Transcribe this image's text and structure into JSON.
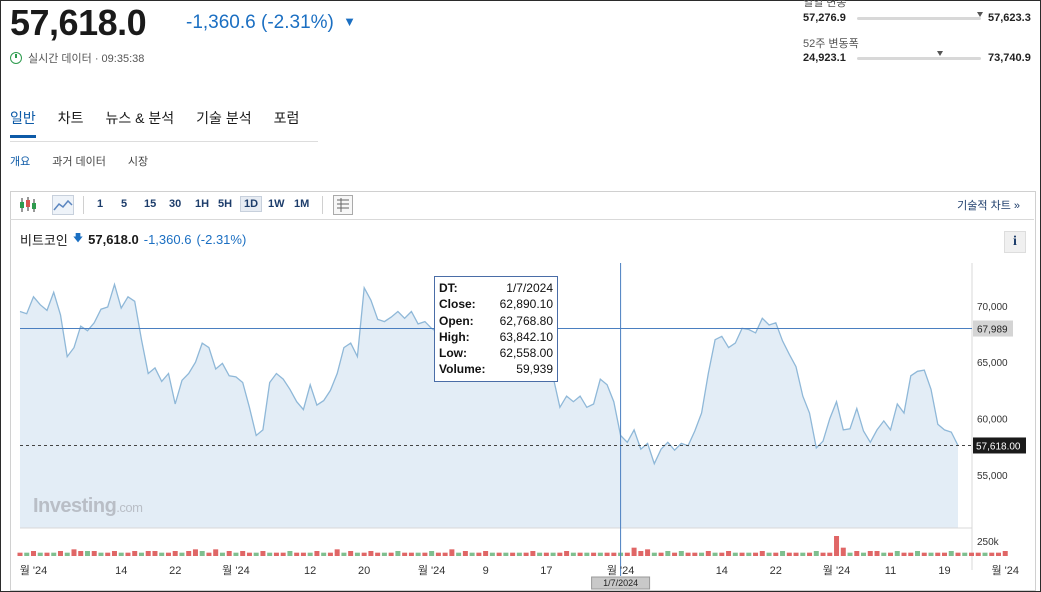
{
  "header": {
    "price": "57,618.0",
    "change": "-1,360.6",
    "change_pct": "(-2.31%)",
    "realtime_label": "실시간 데이터 · 09:35:38"
  },
  "ranges": {
    "day_label": "일일 변동",
    "day_low": "57,276.9",
    "day_high": "57,623.3",
    "day_level": 0.99,
    "week52_label": "52주 변동폭",
    "week52_low": "24,923.1",
    "week52_high": "73,740.9",
    "week52_level": 0.67
  },
  "tabs": [
    "일반",
    "차트",
    "뉴스 & 분석",
    "기술 분석",
    "포럼"
  ],
  "subtabs": [
    "개요",
    "과거 데이터",
    "시장"
  ],
  "toolbar": {
    "intervals": [
      "1",
      "5",
      "15",
      "30",
      "1H",
      "5H",
      "1D",
      "1W",
      "1M"
    ],
    "selected": "1D",
    "tech_chart_link": "기술적 차트 »"
  },
  "legend": {
    "name": "비트코인",
    "price": "57,618.0",
    "change": "-1,360.6",
    "change_pct": "(-2.31%)"
  },
  "info_label": "i",
  "tooltip": {
    "rows": [
      {
        "k": "DT:",
        "v": "1/7/2024"
      },
      {
        "k": "Close:",
        "v": "62,890.10"
      },
      {
        "k": "Open:",
        "v": "62,768.80"
      },
      {
        "k": "High:",
        "v": "63,842.10"
      },
      {
        "k": "Low:",
        "v": "62,558.00"
      },
      {
        "k": "Volume:",
        "v": "59,939"
      }
    ]
  },
  "watermark": {
    "brand": "Investing",
    "suffix": ".com"
  },
  "colors": {
    "up": "#e06666",
    "down": "#7fbf8f",
    "line": "#8fb8d8",
    "area": "#e3edf6",
    "accent": "#1b6fc2"
  },
  "chart_data": {
    "type": "area",
    "y_ticks": [
      "70,000",
      "65,000",
      "60,000",
      "55,000"
    ],
    "y_tick_values": [
      70000,
      65000,
      60000,
      55000
    ],
    "ylim": [
      50300,
      73800
    ],
    "vol_label": "250k",
    "crosshair_value": "67,989",
    "crosshair_price": 67989,
    "last_value": "57,618.00",
    "last_price": 57618,
    "crosshair_date": "1/7/2024",
    "x_labels": [
      "월 '24",
      "14",
      "22",
      "월 '24",
      "12",
      "20",
      "월 '24",
      "9",
      "17",
      "월 '24",
      "14",
      "22",
      "월 '24",
      "11",
      "19",
      "월 '24"
    ],
    "x_label_index": [
      2,
      15,
      23,
      32,
      43,
      51,
      61,
      69,
      78,
      89,
      104,
      112,
      121,
      129,
      137,
      146
    ],
    "crosshair_index": 89,
    "values": [
      69500,
      69300,
      70800,
      70100,
      69600,
      71200,
      69200,
      65500,
      66300,
      68200,
      67800,
      68500,
      69700,
      69900,
      71900,
      69800,
      70800,
      70400,
      67000,
      64000,
      64500,
      63300,
      64000,
      61300,
      63400,
      64000,
      65000,
      66700,
      66300,
      64400,
      64900,
      63800,
      63700,
      63200,
      61000,
      58500,
      59000,
      63200,
      64000,
      63500,
      62600,
      61500,
      60800,
      63000,
      61200,
      61600,
      62500,
      64000,
      66300,
      66700,
      65500,
      71600,
      70500,
      68800,
      68600,
      69000,
      69500,
      68900,
      69500,
      68400,
      68600,
      68000,
      67600,
      67900,
      67900,
      69000,
      70000,
      72000,
      71000,
      71600,
      69000,
      68800,
      69500,
      69000,
      69500,
      67800,
      66400,
      66000,
      64600,
      63700,
      61000,
      62000,
      61500,
      62000,
      61000,
      61300,
      63500,
      63000,
      61500,
      58500,
      57900,
      59000,
      57300,
      57800,
      56000,
      57300,
      57900,
      57200,
      57800,
      57600,
      58900,
      60500,
      64000,
      67000,
      67300,
      66300,
      66700,
      68000,
      67900,
      67600,
      68900,
      68300,
      68500,
      66900,
      65700,
      64600,
      62000,
      60500,
      57400,
      58000,
      60000,
      61500,
      59000,
      59100,
      60900,
      58900,
      57900,
      59000,
      59800,
      59000,
      61300,
      60500,
      63800,
      64200,
      64300,
      62600,
      59500,
      59000,
      58800,
      57618
    ],
    "volumes": [
      2,
      2,
      3,
      2,
      2,
      2,
      3,
      2,
      4,
      3,
      3,
      3,
      2,
      2,
      3,
      2,
      2,
      3,
      2,
      3,
      3,
      2,
      2,
      3,
      2,
      3,
      4,
      3,
      2,
      4,
      2,
      3,
      2,
      3,
      2,
      2,
      3,
      2,
      2,
      2,
      3,
      2,
      2,
      2,
      3,
      2,
      2,
      4,
      2,
      3,
      2,
      2,
      3,
      2,
      2,
      2,
      3,
      2,
      2,
      2,
      2,
      3,
      2,
      2,
      4,
      2,
      3,
      2,
      2,
      3,
      2,
      2,
      2,
      2,
      2,
      2,
      3,
      2,
      2,
      2,
      2,
      3,
      2,
      2,
      2,
      2,
      2,
      2,
      2,
      2,
      2,
      5,
      3,
      4,
      2,
      2,
      3,
      2,
      3,
      2,
      2,
      2,
      3,
      2,
      2,
      3,
      2,
      2,
      2,
      2,
      3,
      2,
      2,
      3,
      2,
      2,
      2,
      2,
      3,
      2,
      2,
      12,
      5,
      2,
      3,
      2,
      3,
      3,
      2,
      2,
      3,
      2,
      2,
      3,
      2,
      2,
      2,
      2,
      3,
      2,
      2,
      2,
      2,
      2,
      2,
      2,
      3
    ],
    "vol_up": [
      1,
      0,
      1,
      0,
      1,
      0,
      1,
      0,
      1,
      1,
      0,
      1,
      0,
      1,
      1,
      0,
      1,
      1,
      0,
      1,
      1,
      0,
      1,
      1,
      0,
      1,
      1,
      0,
      1,
      1,
      0,
      1,
      0,
      1,
      1,
      0,
      1,
      0,
      1,
      1,
      0,
      1,
      1,
      0,
      1,
      0,
      1,
      1,
      0,
      1,
      0,
      1,
      1,
      1,
      0,
      1,
      0,
      1,
      1,
      0,
      1,
      0,
      1,
      1,
      1,
      0,
      1,
      0,
      1,
      1,
      0,
      1,
      0,
      1,
      0,
      1,
      1,
      0,
      1,
      0,
      1,
      1,
      0,
      1,
      0,
      1,
      0,
      1,
      1,
      0,
      1,
      1,
      1,
      1,
      0,
      1,
      0,
      1,
      0,
      1,
      1,
      0,
      1,
      0,
      1,
      1,
      0,
      1,
      0,
      1,
      1,
      0,
      1,
      0,
      1,
      1,
      0,
      1,
      0,
      1,
      1,
      1,
      1,
      0,
      1,
      0,
      1,
      1,
      0,
      1,
      0,
      1,
      1,
      0,
      1,
      0,
      1,
      1,
      0,
      1,
      0,
      1,
      1,
      0,
      1,
      1,
      1
    ],
    "grid": false
  }
}
